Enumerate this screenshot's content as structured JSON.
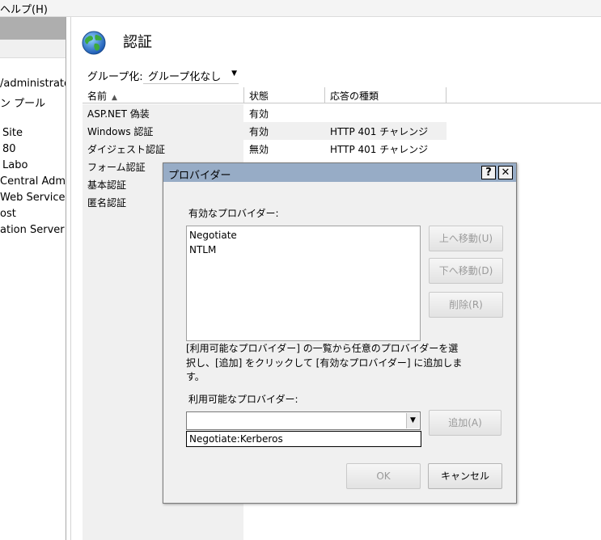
{
  "menu": {
    "help": "ヘルプ(H)"
  },
  "tree": {
    "items": [
      "/administrator",
      "ン プール",
      "Site",
      "80",
      "Labo",
      "Central Admini",
      "Web Services",
      "ost",
      "ation Server"
    ]
  },
  "page": {
    "title": "認証",
    "icon": "globe-icon",
    "group_label": "グループ化:",
    "group_value": "グループ化なし",
    "columns": [
      "名前",
      "状態",
      "応答の種類"
    ],
    "rows": [
      {
        "name": "ASP.NET 偽装",
        "status": "有効",
        "type": ""
      },
      {
        "name": "Windows 認証",
        "status": "有効",
        "type": "HTTP 401 チャレンジ"
      },
      {
        "name": "ダイジェスト認証",
        "status": "無効",
        "type": "HTTP 401 チャレンジ"
      },
      {
        "name": "フォーム認証",
        "status": "",
        "type": ""
      },
      {
        "name": "基本認証",
        "status": "",
        "type": ""
      },
      {
        "name": "匿名認証",
        "status": "",
        "type": ""
      }
    ]
  },
  "dialog": {
    "title": "プロバイダー",
    "help_button": "?",
    "close_button": "✕",
    "enabled_label": "有効なプロバイダー:",
    "enabled_providers": [
      "Negotiate",
      "NTLM"
    ],
    "move_up": "上へ移動(U)",
    "move_down": "下へ移動(D)",
    "remove": "削除(R)",
    "help_line1": "[利用可能なプロバイダー] の一覧から任意のプロバイダーを選",
    "help_line2": "択し、[追加] をクリックして [有効なプロバイダー] に追加しま",
    "help_line3": "す。",
    "available_label": "利用可能なプロバイダー:",
    "available_value": "",
    "available_option": "Negotiate:Kerberos",
    "add": "追加(A)",
    "ok": "OK",
    "cancel": "キャンセル"
  }
}
